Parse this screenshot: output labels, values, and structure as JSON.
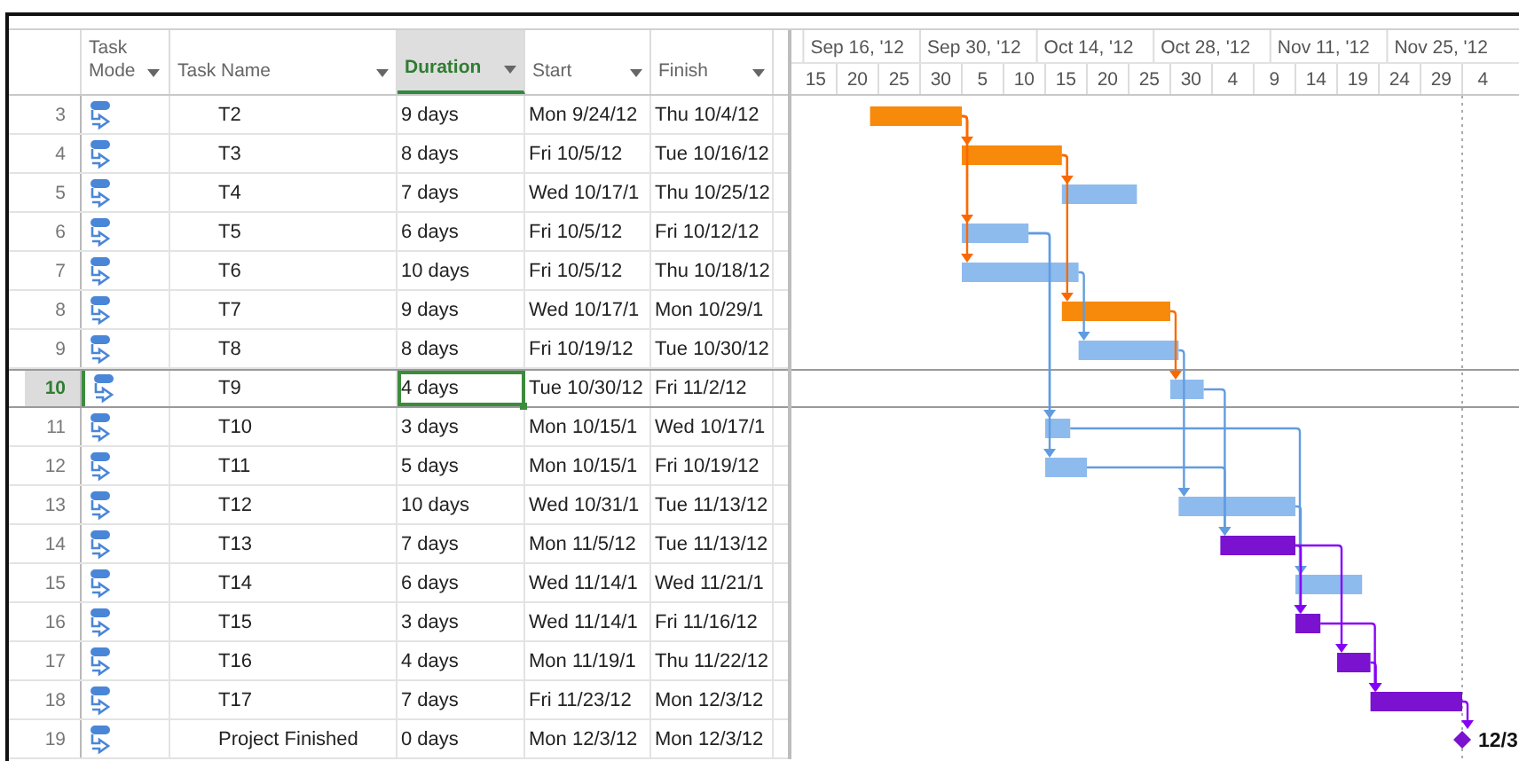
{
  "columns": [
    {
      "label": "Task Mode",
      "selected": false
    },
    {
      "label": "Task Name",
      "selected": false
    },
    {
      "label": "Duration",
      "selected": true
    },
    {
      "label": "Start",
      "selected": false
    },
    {
      "label": "Finish",
      "selected": false
    }
  ],
  "timescale": {
    "major": [
      "Sep 16, '12",
      "Sep 30, '12",
      "Oct 14, '12",
      "Oct 28, '12",
      "Nov 11, '12",
      "Nov 25, '12"
    ],
    "minor": [
      "15",
      "20",
      "25",
      "30",
      "5",
      "10",
      "15",
      "20",
      "25",
      "30",
      "4",
      "9",
      "14",
      "19",
      "24",
      "29",
      "4"
    ]
  },
  "tasks": [
    {
      "row_number": "3",
      "name": "T2",
      "duration": "9 days",
      "start": "Mon 9/24/12",
      "finish": "Thu 10/4/12",
      "kind": "task",
      "color": "#f7890b",
      "selected": false
    },
    {
      "row_number": "4",
      "name": "T3",
      "duration": "8 days",
      "start": "Fri 10/5/12",
      "finish": "Tue 10/16/12",
      "kind": "task",
      "color": "#f7890b",
      "selected": false
    },
    {
      "row_number": "5",
      "name": "T4",
      "duration": "7 days",
      "start": "Wed 10/17/1",
      "finish": "Thu 10/25/12",
      "kind": "task",
      "color": "#8ebbee",
      "selected": false
    },
    {
      "row_number": "6",
      "name": "T5",
      "duration": "6 days",
      "start": "Fri 10/5/12",
      "finish": "Fri 10/12/12",
      "kind": "task",
      "color": "#8ebbee",
      "selected": false
    },
    {
      "row_number": "7",
      "name": "T6",
      "duration": "10 days",
      "start": "Fri 10/5/12",
      "finish": "Thu 10/18/12",
      "kind": "task",
      "color": "#8ebbee",
      "selected": false
    },
    {
      "row_number": "8",
      "name": "T7",
      "duration": "9 days",
      "start": "Wed 10/17/1",
      "finish": "Mon 10/29/1",
      "kind": "task",
      "color": "#f7890b",
      "selected": false
    },
    {
      "row_number": "9",
      "name": "T8",
      "duration": "8 days",
      "start": "Fri 10/19/12",
      "finish": "Tue 10/30/12",
      "kind": "task",
      "color": "#8ebbee",
      "selected": false
    },
    {
      "row_number": "10",
      "name": "T9",
      "duration": "4 days",
      "start": "Tue 10/30/12",
      "finish": "Fri 11/2/12",
      "kind": "task",
      "color": "#8ebbee",
      "selected": true
    },
    {
      "row_number": "11",
      "name": "T10",
      "duration": "3 days",
      "start": "Mon 10/15/1",
      "finish": "Wed 10/17/1",
      "kind": "task",
      "color": "#8ebbee",
      "selected": false
    },
    {
      "row_number": "12",
      "name": "T11",
      "duration": "5 days",
      "start": "Mon 10/15/1",
      "finish": "Fri 10/19/12",
      "kind": "task",
      "color": "#8ebbee",
      "selected": false
    },
    {
      "row_number": "13",
      "name": "T12",
      "duration": "10 days",
      "start": "Wed 10/31/1",
      "finish": "Tue 11/13/12",
      "kind": "task",
      "color": "#8ebbee",
      "selected": false
    },
    {
      "row_number": "14",
      "name": "T13",
      "duration": "7 days",
      "start": "Mon 11/5/12",
      "finish": "Tue 11/13/12",
      "kind": "task",
      "color": "#7a12cf",
      "selected": false
    },
    {
      "row_number": "15",
      "name": "T14",
      "duration": "6 days",
      "start": "Wed 11/14/1",
      "finish": "Wed 11/21/1",
      "kind": "task",
      "color": "#8ebbee",
      "selected": false
    },
    {
      "row_number": "16",
      "name": "T15",
      "duration": "3 days",
      "start": "Wed 11/14/1",
      "finish": "Fri 11/16/12",
      "kind": "task",
      "color": "#7a12cf",
      "selected": false
    },
    {
      "row_number": "17",
      "name": "T16",
      "duration": "4 days",
      "start": "Mon 11/19/1",
      "finish": "Thu 11/22/12",
      "kind": "task",
      "color": "#7a12cf",
      "selected": false
    },
    {
      "row_number": "18",
      "name": "T17",
      "duration": "7 days",
      "start": "Fri 11/23/12",
      "finish": "Mon 12/3/12",
      "kind": "task",
      "color": "#7a12cf",
      "selected": false
    },
    {
      "row_number": "19",
      "name": "Project Finished",
      "duration": "0 days",
      "start": "Mon 12/3/12",
      "finish": "Mon 12/3/12",
      "kind": "milestone",
      "color": "#7a12cf",
      "selected": false,
      "bar_label": "12/3"
    }
  ]
}
